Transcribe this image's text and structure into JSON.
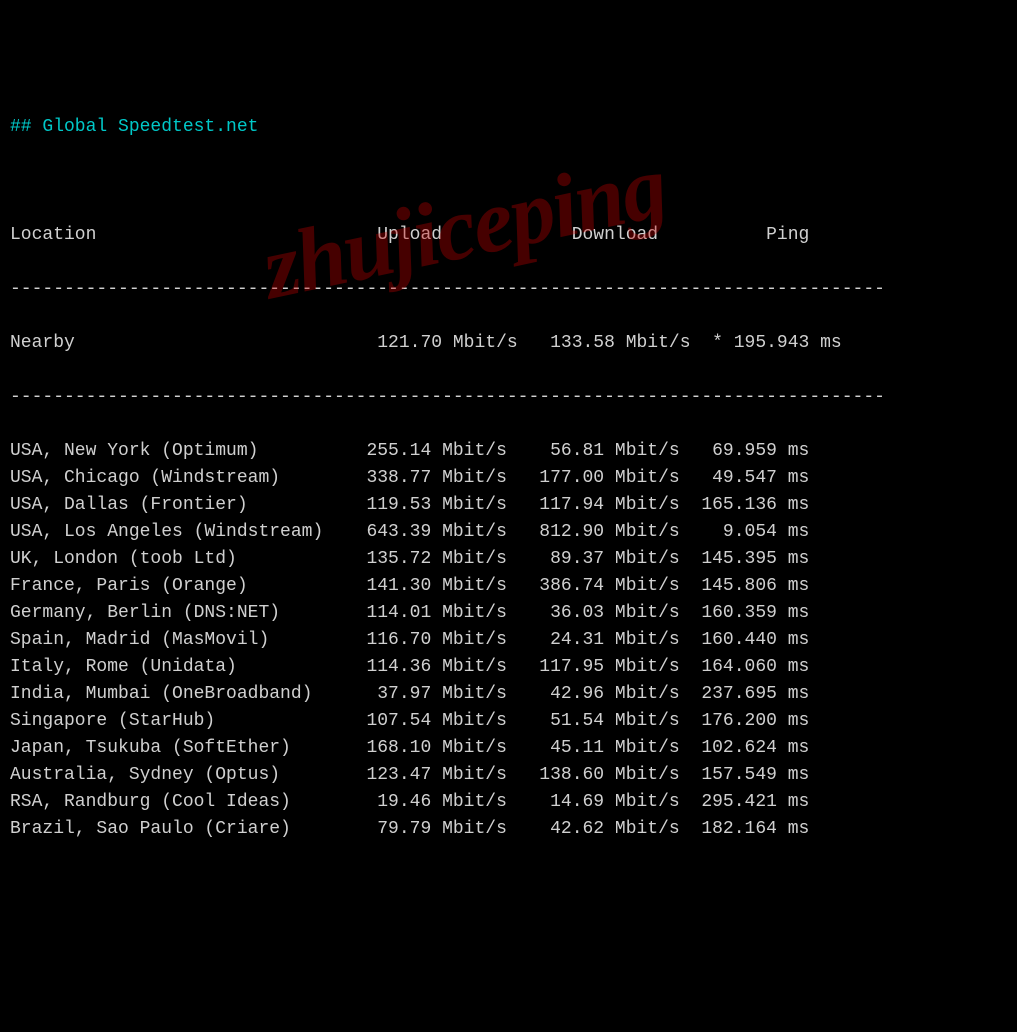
{
  "title": "## Global Speedtest.net",
  "headers": {
    "location": "Location",
    "upload": "Upload",
    "download": "Download",
    "ping": "Ping"
  },
  "divider1": "---------------------------------------------------------------------------------",
  "divider2": "---------------------------------------------------------------------------------",
  "nearby": {
    "location": "Nearby",
    "upload": "121.70 Mbit/s",
    "download": "133.58 Mbit/s",
    "ping": "* 195.943 ms"
  },
  "rows": [
    {
      "location": "USA, New York (Optimum)",
      "upload": "255.14 Mbit/s",
      "download": "56.81 Mbit/s",
      "ping": "69.959 ms"
    },
    {
      "location": "USA, Chicago (Windstream)",
      "upload": "338.77 Mbit/s",
      "download": "177.00 Mbit/s",
      "ping": "49.547 ms"
    },
    {
      "location": "USA, Dallas (Frontier)",
      "upload": "119.53 Mbit/s",
      "download": "117.94 Mbit/s",
      "ping": "165.136 ms"
    },
    {
      "location": "USA, Los Angeles (Windstream)",
      "upload": "643.39 Mbit/s",
      "download": "812.90 Mbit/s",
      "ping": "9.054 ms"
    },
    {
      "location": "UK, London (toob Ltd)",
      "upload": "135.72 Mbit/s",
      "download": "89.37 Mbit/s",
      "ping": "145.395 ms"
    },
    {
      "location": "France, Paris (Orange)",
      "upload": "141.30 Mbit/s",
      "download": "386.74 Mbit/s",
      "ping": "145.806 ms"
    },
    {
      "location": "Germany, Berlin (DNS:NET)",
      "upload": "114.01 Mbit/s",
      "download": "36.03 Mbit/s",
      "ping": "160.359 ms"
    },
    {
      "location": "Spain, Madrid (MasMovil)",
      "upload": "116.70 Mbit/s",
      "download": "24.31 Mbit/s",
      "ping": "160.440 ms"
    },
    {
      "location": "Italy, Rome (Unidata)",
      "upload": "114.36 Mbit/s",
      "download": "117.95 Mbit/s",
      "ping": "164.060 ms"
    },
    {
      "location": "India, Mumbai (OneBroadband)",
      "upload": "37.97 Mbit/s",
      "download": "42.96 Mbit/s",
      "ping": "237.695 ms"
    },
    {
      "location": "Singapore (StarHub)",
      "upload": "107.54 Mbit/s",
      "download": "51.54 Mbit/s",
      "ping": "176.200 ms"
    },
    {
      "location": "Japan, Tsukuba (SoftEther)",
      "upload": "168.10 Mbit/s",
      "download": "45.11 Mbit/s",
      "ping": "102.624 ms"
    },
    {
      "location": "Australia, Sydney (Optus)",
      "upload": "123.47 Mbit/s",
      "download": "138.60 Mbit/s",
      "ping": "157.549 ms"
    },
    {
      "location": "RSA, Randburg (Cool Ideas)",
      "upload": "19.46 Mbit/s",
      "download": "14.69 Mbit/s",
      "ping": "295.421 ms"
    },
    {
      "location": "Brazil, Sao Paulo (Criare)",
      "upload": "79.79 Mbit/s",
      "download": "42.62 Mbit/s",
      "ping": "182.164 ms"
    }
  ],
  "watermark": "zhujiceping"
}
